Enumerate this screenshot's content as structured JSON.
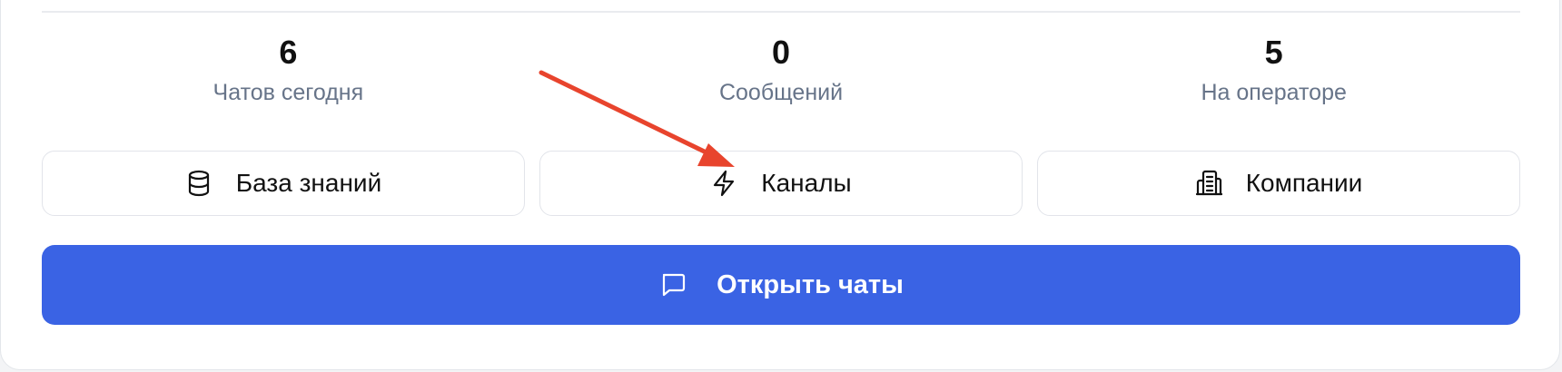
{
  "stats": [
    {
      "value": "6",
      "label": "Чатов сегодня"
    },
    {
      "value": "0",
      "label": "Сообщений"
    },
    {
      "value": "5",
      "label": "На операторе"
    }
  ],
  "actions": [
    {
      "label": "База знаний",
      "icon": "database-icon"
    },
    {
      "label": "Каналы",
      "icon": "lightning-icon"
    },
    {
      "label": "Компании",
      "icon": "building-icon"
    }
  ],
  "primary": {
    "label": "Открыть чаты",
    "icon": "chat-bubble-icon"
  },
  "colors": {
    "primary": "#3a63e4",
    "annotation": "#e8442d",
    "muted_text": "#677489"
  }
}
